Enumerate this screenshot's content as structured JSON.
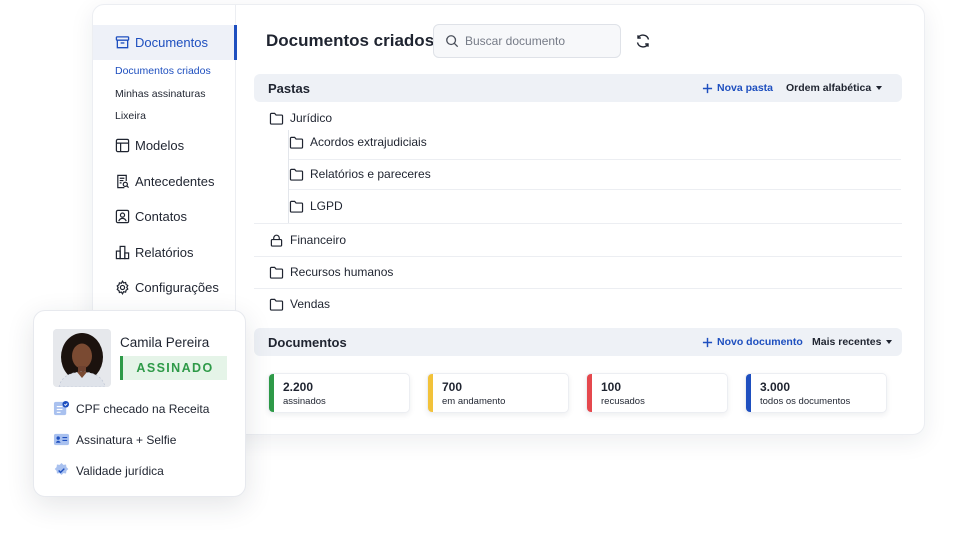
{
  "sidebar": {
    "active": "Documentos",
    "subitems": [
      "Documentos criados",
      "Minhas assinaturas",
      "Lixeira"
    ],
    "items": [
      "Modelos",
      "Antecedentes",
      "Contatos",
      "Relatórios",
      "Configurações"
    ]
  },
  "header": {
    "title": "Documentos criados",
    "search_placeholder": "Buscar documento"
  },
  "folders": {
    "title": "Pastas",
    "add_label": "Nova pasta",
    "sort_label": "Ordem alfabética",
    "items": [
      {
        "label": "Jurídico",
        "icon": "folder-icon"
      },
      {
        "label": "Acordos extrajudiciais",
        "icon": "folder-icon"
      },
      {
        "label": "Relatórios e pareceres",
        "icon": "folder-icon"
      },
      {
        "label": "LGPD",
        "icon": "folder-icon"
      },
      {
        "label": "Financeiro",
        "icon": "lock-icon"
      },
      {
        "label": "Recursos humanos",
        "icon": "folder-icon"
      },
      {
        "label": "Vendas",
        "icon": "folder-icon"
      }
    ]
  },
  "documents": {
    "title": "Documentos",
    "add_label": "Novo documento",
    "sort_label": "Mais recentes",
    "stats": [
      {
        "value": "2.200",
        "label": "assinados",
        "color": "#2e9a48"
      },
      {
        "value": "700",
        "label": "em andamento",
        "color": "#f2c23a"
      },
      {
        "value": "100",
        "label": "recusados",
        "color": "#e5484d"
      },
      {
        "value": "3.000",
        "label": "todos os documentos",
        "color": "#1e4fbf"
      }
    ]
  },
  "signer_card": {
    "name": "Camila Pereira",
    "status": "ASSINADO",
    "checks": [
      "CPF checado na Receita",
      "Assinatura + Selfie",
      "Validade jurídica"
    ]
  },
  "colors": {
    "accent": "#1e4fbf",
    "success": "#2e9a48"
  }
}
